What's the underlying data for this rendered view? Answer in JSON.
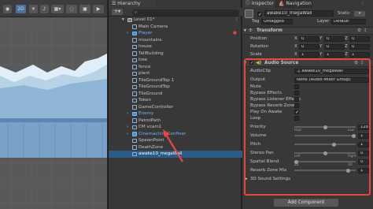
{
  "scene": {
    "toolbar": {
      "mode_label": "2D"
    }
  },
  "hierarchy": {
    "tab_label": "Hierarchy",
    "items": [
      {
        "label": "Level 01*",
        "depth": 0,
        "kind": "scene",
        "blue": false
      },
      {
        "label": "Main Camera",
        "depth": 1,
        "kind": "object",
        "blue": false
      },
      {
        "label": "Player",
        "depth": 1,
        "kind": "prefab",
        "blue": true
      },
      {
        "label": "mountains",
        "depth": 1,
        "kind": "object",
        "blue": false
      },
      {
        "label": "house",
        "depth": 1,
        "kind": "object",
        "blue": false
      },
      {
        "label": "TallBuilding",
        "depth": 1,
        "kind": "object",
        "blue": false
      },
      {
        "label": "tree",
        "depth": 1,
        "kind": "object",
        "blue": false
      },
      {
        "label": "fence",
        "depth": 1,
        "kind": "object",
        "blue": false
      },
      {
        "label": "plant",
        "depth": 1,
        "kind": "object",
        "blue": false
      },
      {
        "label": "TileGroundTop 1",
        "depth": 1,
        "kind": "object",
        "blue": false
      },
      {
        "label": "TileGroundTop",
        "depth": 1,
        "kind": "object",
        "blue": false
      },
      {
        "label": "TileGround",
        "depth": 1,
        "kind": "object",
        "blue": false
      },
      {
        "label": "Token",
        "depth": 1,
        "kind": "object",
        "blue": false
      },
      {
        "label": "GameController",
        "depth": 1,
        "kind": "object",
        "blue": false
      },
      {
        "label": "Enemy",
        "depth": 1,
        "kind": "prefab",
        "blue": true
      },
      {
        "label": "PatrolPath",
        "depth": 1,
        "kind": "object",
        "blue": false
      },
      {
        "label": "CM vcam1",
        "depth": 1,
        "kind": "object",
        "blue": false
      },
      {
        "label": "CinemachineConfiner",
        "depth": 1,
        "kind": "prefab",
        "blue": true
      },
      {
        "label": "SpawnPoint",
        "depth": 1,
        "kind": "object",
        "blue": false
      },
      {
        "label": "DeathZone",
        "depth": 1,
        "kind": "object",
        "blue": false
      },
      {
        "label": "awake10_megaWall",
        "depth": 1,
        "kind": "object",
        "blue": false,
        "selected": true
      }
    ]
  },
  "inspector": {
    "tabs": [
      "Inspector",
      "Navigation"
    ],
    "object_name": "awake10_megaWall",
    "static_label": "Static",
    "tag_label": "Tag",
    "tag_value": "Untagged",
    "layer_label": "Layer",
    "layer_value": "Default",
    "transform": {
      "title": "Transform",
      "rows": [
        {
          "label": "Position",
          "x": "0",
          "y": "0",
          "z": "0"
        },
        {
          "label": "Rotation",
          "x": "0",
          "y": "0",
          "z": "0"
        },
        {
          "label": "Scale",
          "x": "1",
          "y": "1",
          "z": "1"
        }
      ],
      "axis_labels": [
        "X",
        "Y",
        "Z"
      ]
    },
    "audio_source": {
      "title": "Audio Source",
      "audio_clip_label": "AudioClip",
      "audio_clip_value": "awake10_megaWall",
      "output_label": "Output",
      "output_value": "None (Audio Mixer Group)",
      "mute_label": "Mute",
      "bypass_effects_label": "Bypass Effects",
      "bypass_listener_label": "Bypass Listener Effects",
      "bypass_reverb_label": "Bypass Reverb Zones",
      "play_on_awake_label": "Play On Awake",
      "play_on_awake_checked": true,
      "loop_label": "Loop",
      "priority_label": "Priority",
      "priority_value": "128",
      "priority_fraction": 0.5,
      "priority_min_label": "High",
      "priority_max_label": "Low",
      "volume_label": "Volume",
      "volume_value": "1",
      "volume_fraction": 1.0,
      "pitch_label": "Pitch",
      "pitch_value": "1",
      "pitch_fraction": 0.66,
      "stereo_pan_label": "Stereo Pan",
      "stereo_pan_value": "0",
      "stereo_pan_fraction": 0.5,
      "stereo_pan_min_label": "Left",
      "stereo_pan_max_label": "Right",
      "spatial_blend_label": "Spatial Blend",
      "spatial_blend_value": "0",
      "spatial_blend_fraction": 0.0,
      "spatial_min_label": "2D",
      "spatial_max_label": "3D",
      "reverb_mix_label": "Reverb Zone Mix",
      "reverb_mix_value": "1",
      "reverb_mix_fraction": 0.9,
      "sound_settings_label": "3D Sound Settings"
    },
    "add_component_label": "Add Component"
  },
  "colors": {
    "selection": "#2c5d87",
    "highlight_box": "#e8453c",
    "prefab_text": "#6fb6ff"
  }
}
